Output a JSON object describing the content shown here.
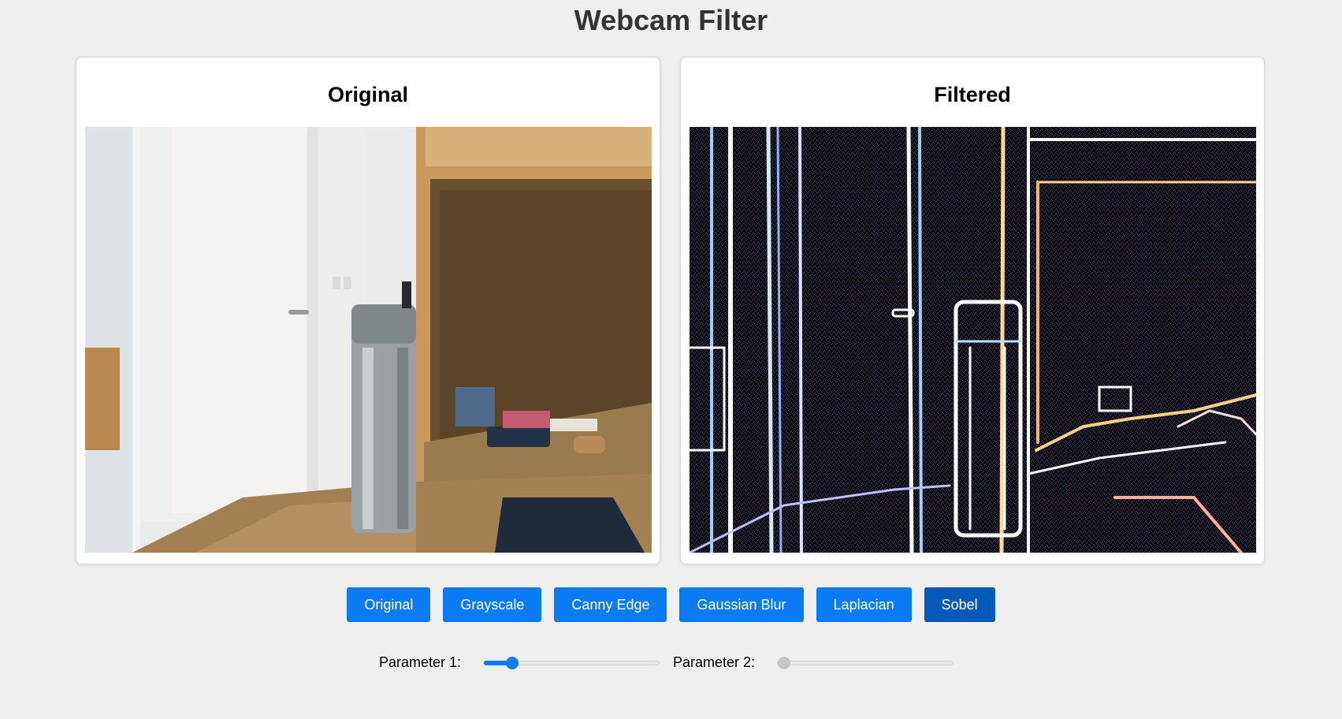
{
  "page": {
    "title": "Webcam Filter"
  },
  "panels": {
    "original": {
      "title": "Original"
    },
    "filtered": {
      "title": "Filtered"
    }
  },
  "filters": [
    {
      "label": "Original",
      "active": false
    },
    {
      "label": "Grayscale",
      "active": false
    },
    {
      "label": "Canny Edge",
      "active": false
    },
    {
      "label": "Gaussian Blur",
      "active": false
    },
    {
      "label": "Laplacian",
      "active": false
    },
    {
      "label": "Sobel",
      "active": true
    }
  ],
  "params": {
    "param1": {
      "label": "Parameter 1:",
      "fraction": 0.16,
      "enabled": true
    },
    "param2": {
      "label": "Parameter 2:",
      "fraction": 0.0,
      "enabled": false
    }
  },
  "colors": {
    "accent": "#0a7bf2",
    "accent_active": "#0559b8",
    "background": "#efefef"
  }
}
